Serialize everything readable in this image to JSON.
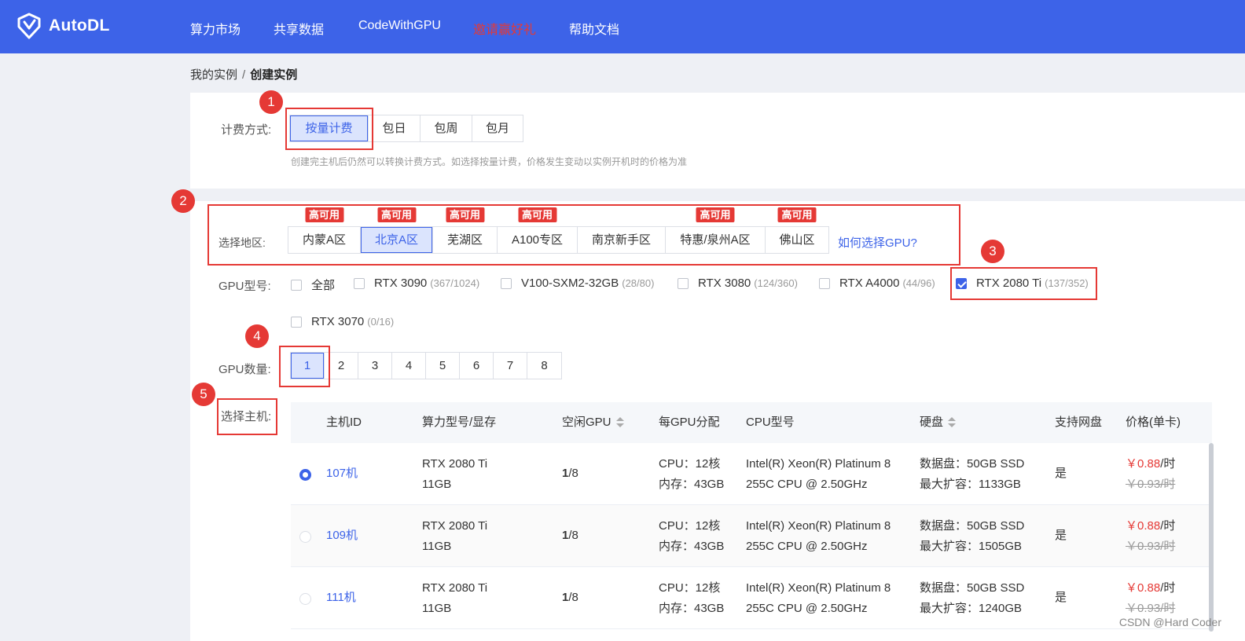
{
  "header": {
    "brand": "AutoDL",
    "nav": [
      "算力市场",
      "共享数据",
      "CodeWithGPU",
      "邀请赢好礼",
      "帮助文档"
    ],
    "highlight_color": "#e53935",
    "bg_color": "#3d63e8"
  },
  "breadcrumb": {
    "parent": "我的实例",
    "separator": "/",
    "current": "创建实例"
  },
  "billing": {
    "label": "计费方式:",
    "options": [
      "按量计费",
      "包日",
      "包周",
      "包月"
    ],
    "selected": "按量计费",
    "hint": "创建完主机后仍然可以转换计费方式。如选择按量计费，价格发生变动以实例开机时的价格为准"
  },
  "region": {
    "label": "选择地区:",
    "options": [
      {
        "name": "内蒙A区",
        "tag": "高可用"
      },
      {
        "name": "北京A区",
        "tag": "高可用"
      },
      {
        "name": "芜湖区",
        "tag": "高可用"
      },
      {
        "name": "A100专区",
        "tag": "高可用"
      },
      {
        "name": "南京新手区",
        "tag": ""
      },
      {
        "name": "特惠/泉州A区",
        "tag": "高可用"
      },
      {
        "name": "佛山区",
        "tag": "高可用"
      }
    ],
    "selected": "北京A区",
    "help_link": "如何选择GPU?"
  },
  "gpu_model": {
    "label": "GPU型号:",
    "options": [
      {
        "name": "全部",
        "count": "",
        "checked": false
      },
      {
        "name": "RTX 3090",
        "count": "(367/1024)",
        "checked": false
      },
      {
        "name": "V100-SXM2-32GB",
        "count": "(28/80)",
        "checked": false
      },
      {
        "name": "RTX 3080",
        "count": "(124/360)",
        "checked": false
      },
      {
        "name": "RTX A4000",
        "count": "(44/96)",
        "checked": false
      },
      {
        "name": "RTX 2080 Ti",
        "count": "(137/352)",
        "checked": true
      },
      {
        "name": "RTX 3070",
        "count": "(0/16)",
        "checked": false
      }
    ]
  },
  "gpu_count": {
    "label": "GPU数量:",
    "options": [
      "1",
      "2",
      "3",
      "4",
      "5",
      "6",
      "7",
      "8"
    ],
    "selected": "1"
  },
  "host": {
    "label": "选择主机:",
    "columns": [
      "主机ID",
      "算力型号/显存",
      "空闲GPU",
      "每GPU分配",
      "CPU型号",
      "硬盘",
      "支持网盘",
      "价格(单卡)"
    ],
    "rows": [
      {
        "selected": true,
        "id": "107机",
        "model": "RTX 2080 Ti",
        "vram": "11GB",
        "free_gpu": "1",
        "total_gpu": "/8",
        "cpu": "CPU：12核",
        "mem": "内存：43GB",
        "cpu_model_1": "Intel(R) Xeon(R) Platinum 8",
        "cpu_model_2": "255C CPU @ 2.50GHz",
        "disk": "数据盘：50GB SSD",
        "disk_max": "最大扩容：1133GB",
        "netdisk": "是",
        "price": "￥0.88",
        "price_unit": "/时",
        "old_price": "￥0.93/时"
      },
      {
        "selected": false,
        "id": "109机",
        "model": "RTX 2080 Ti",
        "vram": "11GB",
        "free_gpu": "1",
        "total_gpu": "/8",
        "cpu": "CPU：12核",
        "mem": "内存：43GB",
        "cpu_model_1": "Intel(R) Xeon(R) Platinum 8",
        "cpu_model_2": "255C CPU @ 2.50GHz",
        "disk": "数据盘：50GB SSD",
        "disk_max": "最大扩容：1505GB",
        "netdisk": "是",
        "price": "￥0.88",
        "price_unit": "/时",
        "old_price": "￥0.93/时"
      },
      {
        "selected": false,
        "id": "111机",
        "model": "RTX 2080 Ti",
        "vram": "11GB",
        "free_gpu": "1",
        "total_gpu": "/8",
        "cpu": "CPU：12核",
        "mem": "内存：43GB",
        "cpu_model_1": "Intel(R) Xeon(R) Platinum 8",
        "cpu_model_2": "255C CPU @ 2.50GHz",
        "disk": "数据盘：50GB SSD",
        "disk_max": "最大扩容：1240GB",
        "netdisk": "是",
        "price": "￥0.88",
        "price_unit": "/时",
        "old_price": "￥0.93/时"
      }
    ]
  },
  "annotations": [
    "1",
    "2",
    "3",
    "4",
    "5"
  ],
  "watermark": "CSDN @Hard Coder"
}
